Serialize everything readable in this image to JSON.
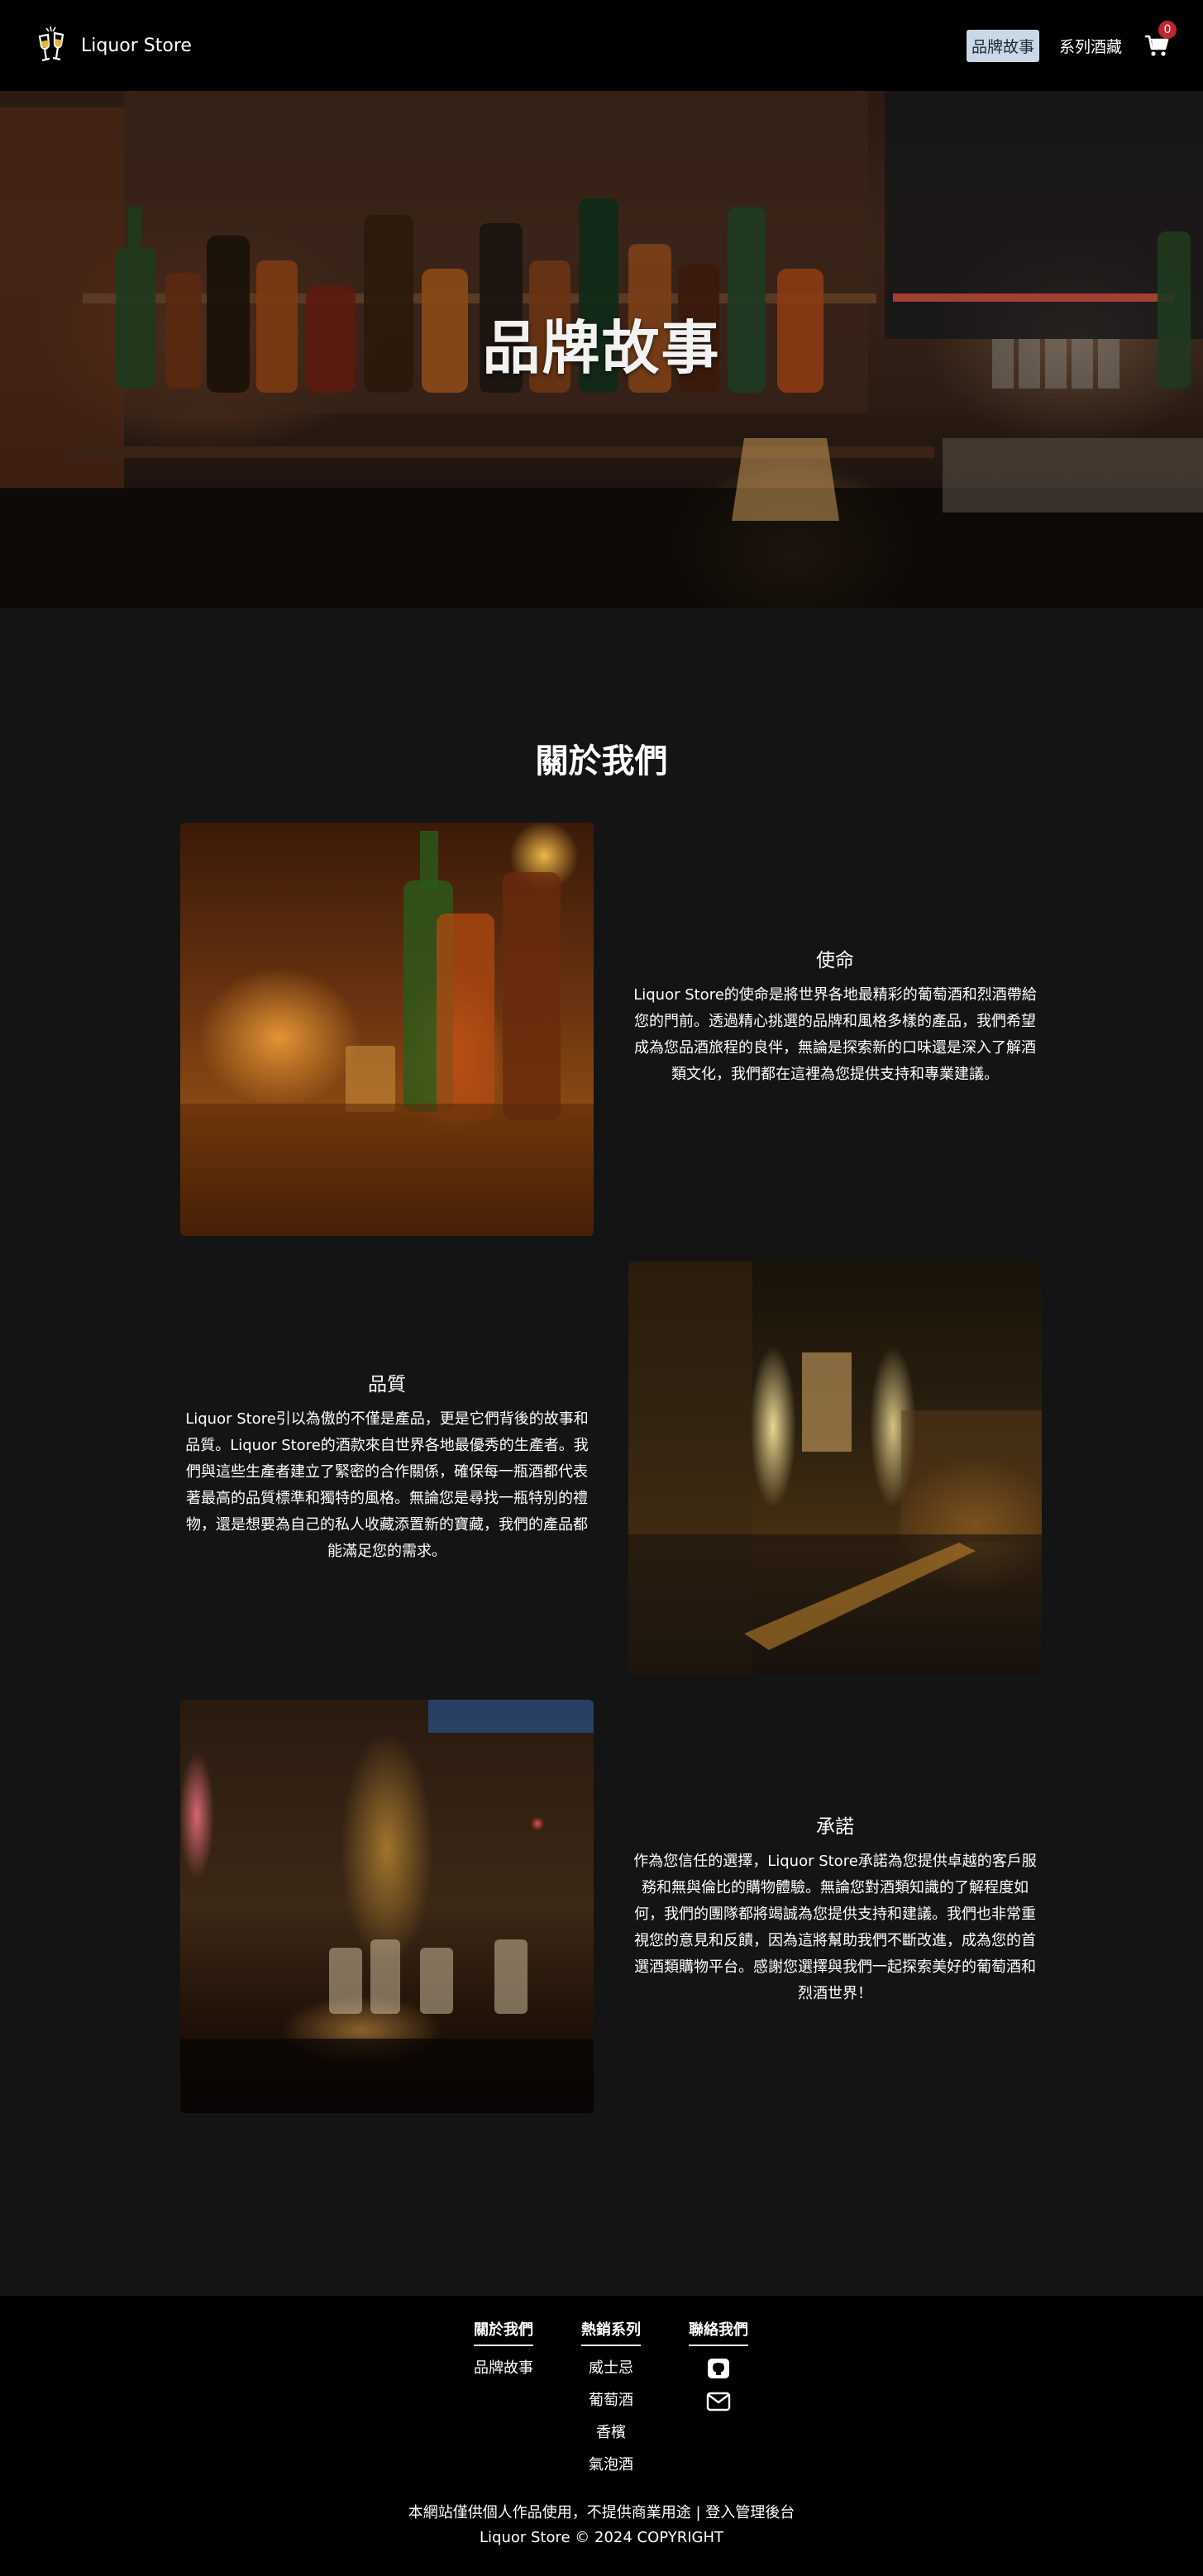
{
  "navbar": {
    "brand_name": "Liquor Store",
    "links": [
      {
        "label": "品牌故事",
        "active": true
      },
      {
        "label": "系列酒藏",
        "active": false
      }
    ],
    "cart_count": "0"
  },
  "hero": {
    "title": "品牌故事"
  },
  "about": {
    "title": "關於我們",
    "sections": [
      {
        "heading": "使命",
        "body": "Liquor Store的使命是將世界各地最精彩的葡萄酒和烈酒帶給您的門前。透過精心挑選的品牌和風格多樣的產品，我們希望成為您品酒旅程的良伴，無論是探索新的口味還是深入了解酒類文化，我們都在這裡為您提供支持和專業建議。"
      },
      {
        "heading": "品質",
        "body": "Liquor Store引以為傲的不僅是產品，更是它們背後的故事和品質。Liquor Store的酒款來自世界各地最優秀的生產者。我們與這些生產者建立了緊密的合作關係，確保每一瓶酒都代表著最高的品質標準和獨特的風格。無論您是尋找一瓶特別的禮物，還是想要為自己的私人收藏添置新的寶藏，我們的產品都能滿足您的需求。"
      },
      {
        "heading": "承諾",
        "body": "作為您信任的選擇，Liquor Store承諾為您提供卓越的客戶服務和無與倫比的購物體驗。無論您對酒類知識的了解程度如何，我們的團隊都將竭誠為您提供支持和建議。我們也非常重視您的意見和反饋，因為這將幫助我們不斷改進，成為您的首選酒類購物平台。感謝您選擇與我們一起探索美好的葡萄酒和烈酒世界！"
      }
    ]
  },
  "footer": {
    "columns": [
      {
        "heading": "關於我們",
        "links": [
          "品牌故事"
        ]
      },
      {
        "heading": "熱銷系列",
        "links": [
          "威士忌",
          "葡萄酒",
          "香檳",
          "氣泡酒"
        ]
      },
      {
        "heading": "聯絡我們",
        "icons": [
          "github-icon",
          "envelope-icon"
        ]
      }
    ],
    "note_line1": "本網站僅供個人作品使用，不提供商業用途 | 登入管理後台",
    "note_line2": "Liquor Store © 2024 COPYRIGHT"
  },
  "colors": {
    "page_bg": "#141414",
    "navbar_bg": "#000000",
    "active_link_bg": "#c9d8e4",
    "cart_badge": "#c0262d"
  }
}
